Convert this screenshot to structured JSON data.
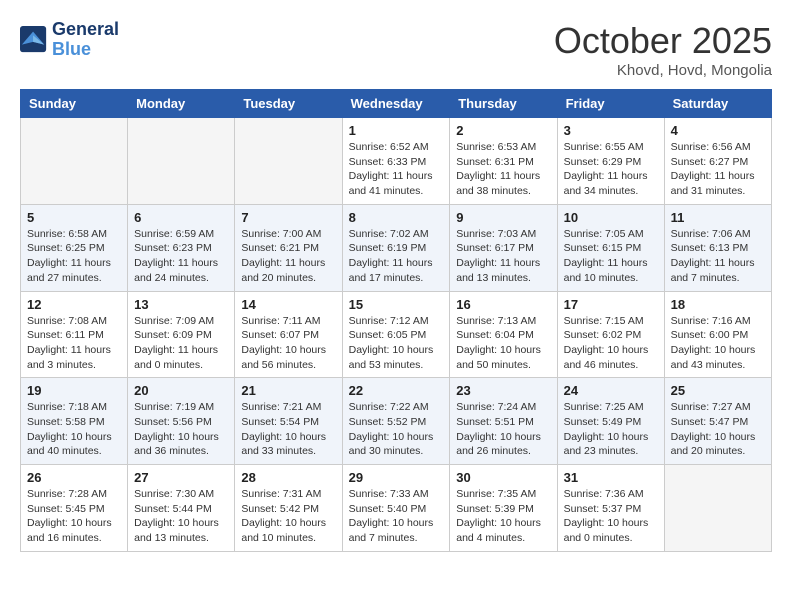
{
  "header": {
    "logo_line1": "General",
    "logo_line2": "Blue",
    "month": "October 2025",
    "location": "Khovd, Hovd, Mongolia"
  },
  "days_of_week": [
    "Sunday",
    "Monday",
    "Tuesday",
    "Wednesday",
    "Thursday",
    "Friday",
    "Saturday"
  ],
  "weeks": [
    [
      {
        "day": "",
        "info": ""
      },
      {
        "day": "",
        "info": ""
      },
      {
        "day": "",
        "info": ""
      },
      {
        "day": "1",
        "info": "Sunrise: 6:52 AM\nSunset: 6:33 PM\nDaylight: 11 hours\nand 41 minutes."
      },
      {
        "day": "2",
        "info": "Sunrise: 6:53 AM\nSunset: 6:31 PM\nDaylight: 11 hours\nand 38 minutes."
      },
      {
        "day": "3",
        "info": "Sunrise: 6:55 AM\nSunset: 6:29 PM\nDaylight: 11 hours\nand 34 minutes."
      },
      {
        "day": "4",
        "info": "Sunrise: 6:56 AM\nSunset: 6:27 PM\nDaylight: 11 hours\nand 31 minutes."
      }
    ],
    [
      {
        "day": "5",
        "info": "Sunrise: 6:58 AM\nSunset: 6:25 PM\nDaylight: 11 hours\nand 27 minutes."
      },
      {
        "day": "6",
        "info": "Sunrise: 6:59 AM\nSunset: 6:23 PM\nDaylight: 11 hours\nand 24 minutes."
      },
      {
        "day": "7",
        "info": "Sunrise: 7:00 AM\nSunset: 6:21 PM\nDaylight: 11 hours\nand 20 minutes."
      },
      {
        "day": "8",
        "info": "Sunrise: 7:02 AM\nSunset: 6:19 PM\nDaylight: 11 hours\nand 17 minutes."
      },
      {
        "day": "9",
        "info": "Sunrise: 7:03 AM\nSunset: 6:17 PM\nDaylight: 11 hours\nand 13 minutes."
      },
      {
        "day": "10",
        "info": "Sunrise: 7:05 AM\nSunset: 6:15 PM\nDaylight: 11 hours\nand 10 minutes."
      },
      {
        "day": "11",
        "info": "Sunrise: 7:06 AM\nSunset: 6:13 PM\nDaylight: 11 hours\nand 7 minutes."
      }
    ],
    [
      {
        "day": "12",
        "info": "Sunrise: 7:08 AM\nSunset: 6:11 PM\nDaylight: 11 hours\nand 3 minutes."
      },
      {
        "day": "13",
        "info": "Sunrise: 7:09 AM\nSunset: 6:09 PM\nDaylight: 11 hours\nand 0 minutes."
      },
      {
        "day": "14",
        "info": "Sunrise: 7:11 AM\nSunset: 6:07 PM\nDaylight: 10 hours\nand 56 minutes."
      },
      {
        "day": "15",
        "info": "Sunrise: 7:12 AM\nSunset: 6:05 PM\nDaylight: 10 hours\nand 53 minutes."
      },
      {
        "day": "16",
        "info": "Sunrise: 7:13 AM\nSunset: 6:04 PM\nDaylight: 10 hours\nand 50 minutes."
      },
      {
        "day": "17",
        "info": "Sunrise: 7:15 AM\nSunset: 6:02 PM\nDaylight: 10 hours\nand 46 minutes."
      },
      {
        "day": "18",
        "info": "Sunrise: 7:16 AM\nSunset: 6:00 PM\nDaylight: 10 hours\nand 43 minutes."
      }
    ],
    [
      {
        "day": "19",
        "info": "Sunrise: 7:18 AM\nSunset: 5:58 PM\nDaylight: 10 hours\nand 40 minutes."
      },
      {
        "day": "20",
        "info": "Sunrise: 7:19 AM\nSunset: 5:56 PM\nDaylight: 10 hours\nand 36 minutes."
      },
      {
        "day": "21",
        "info": "Sunrise: 7:21 AM\nSunset: 5:54 PM\nDaylight: 10 hours\nand 33 minutes."
      },
      {
        "day": "22",
        "info": "Sunrise: 7:22 AM\nSunset: 5:52 PM\nDaylight: 10 hours\nand 30 minutes."
      },
      {
        "day": "23",
        "info": "Sunrise: 7:24 AM\nSunset: 5:51 PM\nDaylight: 10 hours\nand 26 minutes."
      },
      {
        "day": "24",
        "info": "Sunrise: 7:25 AM\nSunset: 5:49 PM\nDaylight: 10 hours\nand 23 minutes."
      },
      {
        "day": "25",
        "info": "Sunrise: 7:27 AM\nSunset: 5:47 PM\nDaylight: 10 hours\nand 20 minutes."
      }
    ],
    [
      {
        "day": "26",
        "info": "Sunrise: 7:28 AM\nSunset: 5:45 PM\nDaylight: 10 hours\nand 16 minutes."
      },
      {
        "day": "27",
        "info": "Sunrise: 7:30 AM\nSunset: 5:44 PM\nDaylight: 10 hours\nand 13 minutes."
      },
      {
        "day": "28",
        "info": "Sunrise: 7:31 AM\nSunset: 5:42 PM\nDaylight: 10 hours\nand 10 minutes."
      },
      {
        "day": "29",
        "info": "Sunrise: 7:33 AM\nSunset: 5:40 PM\nDaylight: 10 hours\nand 7 minutes."
      },
      {
        "day": "30",
        "info": "Sunrise: 7:35 AM\nSunset: 5:39 PM\nDaylight: 10 hours\nand 4 minutes."
      },
      {
        "day": "31",
        "info": "Sunrise: 7:36 AM\nSunset: 5:37 PM\nDaylight: 10 hours\nand 0 minutes."
      },
      {
        "day": "",
        "info": ""
      }
    ]
  ]
}
